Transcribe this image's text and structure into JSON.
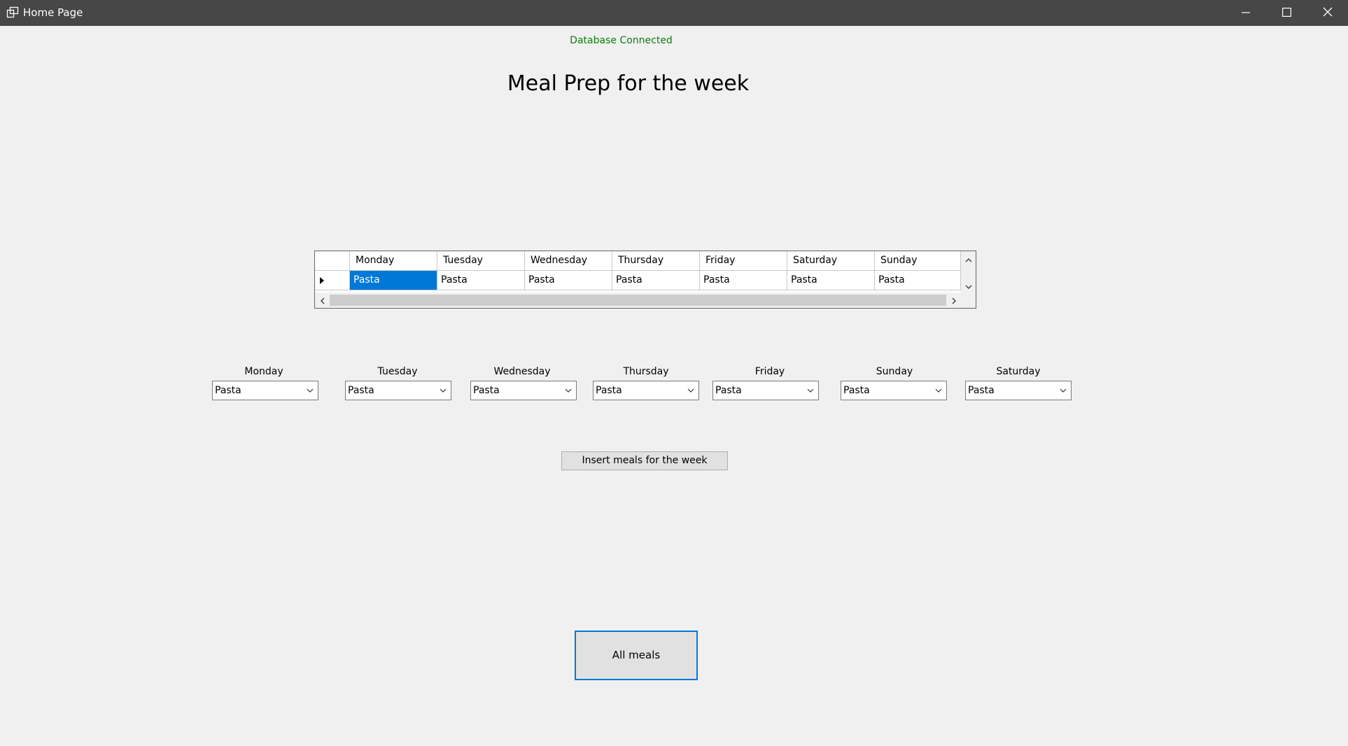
{
  "window": {
    "title": "Home Page",
    "controls": {
      "minimize": "minimize-icon",
      "maximize": "maximize-icon",
      "close": "close-icon"
    }
  },
  "status_text": "Database Connected",
  "heading": "Meal Prep for the week",
  "grid": {
    "columns": [
      "Monday",
      "Tuesday",
      "Wednesday",
      "Thursday",
      "Friday",
      "Saturday",
      "Sunday"
    ],
    "rows": [
      [
        "Pasta",
        "Pasta",
        "Pasta",
        "Pasta",
        "Pasta",
        "Pasta",
        "Pasta"
      ]
    ],
    "selected_cell": "Monday"
  },
  "selectors": [
    {
      "label": "Monday",
      "value": "Pasta"
    },
    {
      "label": "Tuesday",
      "value": "Pasta"
    },
    {
      "label": "Wednesday",
      "value": "Pasta"
    },
    {
      "label": "Thursday",
      "value": "Pasta"
    },
    {
      "label": "Friday",
      "value": "Pasta"
    },
    {
      "label": "Sunday",
      "value": "Pasta"
    },
    {
      "label": "Saturday",
      "value": "Pasta"
    }
  ],
  "buttons": {
    "insert": "Insert meals for the week",
    "all_meals": "All meals"
  },
  "colors": {
    "titlebar": "#474747",
    "status_green": "#0a7f0a",
    "selection_blue": "#0078d7"
  }
}
